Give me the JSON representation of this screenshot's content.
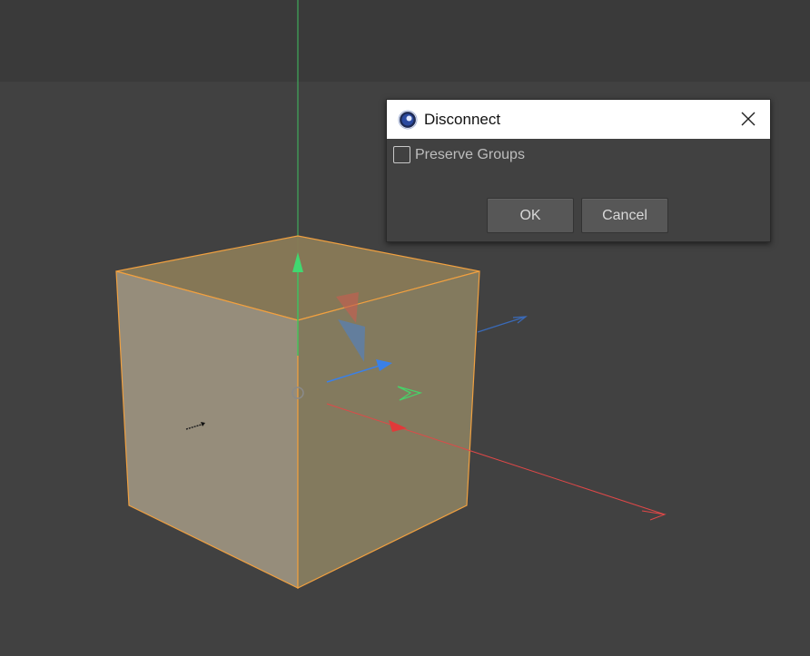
{
  "dialog": {
    "title": "Disconnect",
    "preserve_groups_label": "Preserve Groups",
    "preserve_groups_checked": false,
    "ok_label": "OK",
    "cancel_label": "Cancel"
  },
  "icons": {
    "app": "cinema4d-logo-icon",
    "close": "close-icon",
    "cursor": "mouse-cursor-icon"
  },
  "colors": {
    "viewport_bg": "#414141",
    "top_band": "#3a3a3a",
    "cube_outline": "#f0a040",
    "cube_front_face": "#948a78",
    "cube_right_face": "#847a5e",
    "cube_top_face": "#8a7b5a",
    "axis_x": "#e04848",
    "axis_y": "#48d068",
    "axis_z": "#3a80e8"
  }
}
